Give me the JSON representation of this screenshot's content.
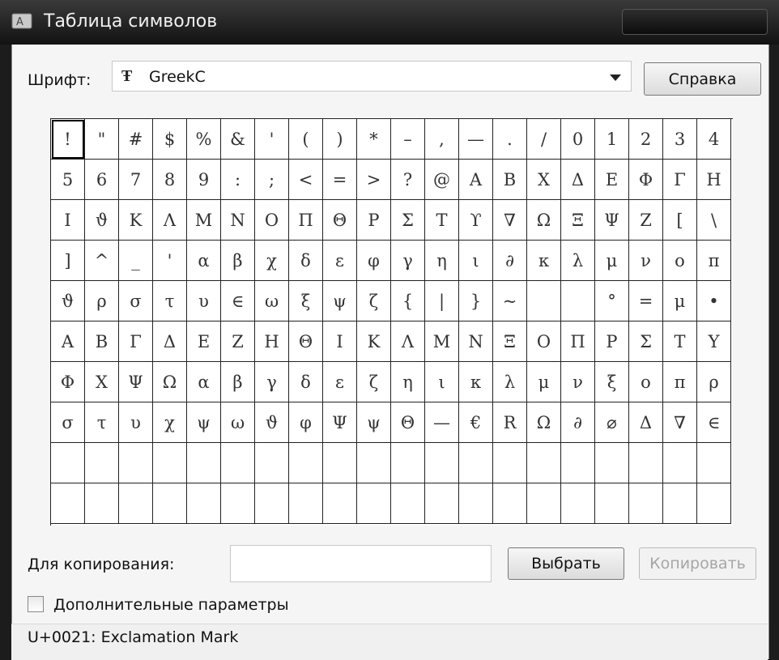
{
  "window": {
    "title": "Таблица символов"
  },
  "font": {
    "label": "Шрифт:",
    "value": "GreekC",
    "icon": "truetype-font-icon"
  },
  "buttons": {
    "help": "Справка",
    "select": "Выбрать",
    "copy": "Копировать"
  },
  "copy": {
    "label": "Для копирования:",
    "value": ""
  },
  "advanced": {
    "label": "Дополнительные параметры",
    "checked": false
  },
  "status": "U+0021: Exclamation Mark",
  "grid": {
    "columns": 20,
    "rows": 10,
    "selected_index": 0,
    "symbols": [
      "!",
      "\"",
      "#",
      "$",
      "%",
      "&",
      "'",
      "(",
      ")",
      "*",
      "–",
      ",",
      "—",
      ".",
      "/",
      "0",
      "1",
      "2",
      "3",
      "4",
      "5",
      "6",
      "7",
      "8",
      "9",
      ":",
      ";",
      "<",
      "=",
      ">",
      "?",
      "@",
      "A",
      "B",
      "X",
      "Δ",
      "E",
      "Φ",
      "Γ",
      "H",
      "I",
      "ϑ",
      "K",
      "Λ",
      "M",
      "N",
      "O",
      "Π",
      "Θ",
      "P",
      "Σ",
      "T",
      "ϒ",
      "∇",
      "Ω",
      "Ξ",
      "Ψ",
      "Z",
      "[",
      "\\",
      "]",
      "^",
      "_",
      "'",
      "α",
      "β",
      "χ",
      "δ",
      "ε",
      "φ",
      "γ",
      "η",
      "ι",
      "∂",
      "κ",
      "λ",
      "μ",
      "ν",
      "o",
      "π",
      "ϑ",
      "ρ",
      "σ",
      "τ",
      "υ",
      "∈",
      "ω",
      "ξ",
      "ψ",
      "ζ",
      "{",
      "|",
      "}",
      "~",
      "",
      "",
      "°",
      "=",
      "μ",
      "•",
      "A",
      "B",
      "Γ",
      "Δ",
      "E",
      "Z",
      "H",
      "Θ",
      "I",
      "K",
      "Λ",
      "M",
      "N",
      "Ξ",
      "O",
      "Π",
      "P",
      "Σ",
      "T",
      "Y",
      "Φ",
      "X",
      "Ψ",
      "Ω",
      "α",
      "β",
      "γ",
      "δ",
      "ε",
      "ζ",
      "η",
      "ι",
      "κ",
      "λ",
      "μ",
      "ν",
      "ξ",
      "o",
      "π",
      "ρ",
      "σ",
      "τ",
      "υ",
      "χ",
      "ψ",
      "ω",
      "ϑ",
      "φ",
      "Ψ",
      "ψ",
      "Θ",
      "—",
      "€",
      "R",
      "Ω",
      "∂",
      "⌀",
      "Δ",
      "∇",
      "∈",
      "",
      "",
      "",
      "",
      "",
      "",
      "",
      "",
      "",
      "",
      "",
      "",
      "",
      "",
      "",
      "",
      "",
      "",
      "",
      "",
      "",
      "",
      "",
      "",
      "",
      "",
      "",
      "",
      "",
      "",
      "",
      "",
      "",
      "",
      "",
      "",
      "",
      "",
      "",
      ""
    ]
  }
}
